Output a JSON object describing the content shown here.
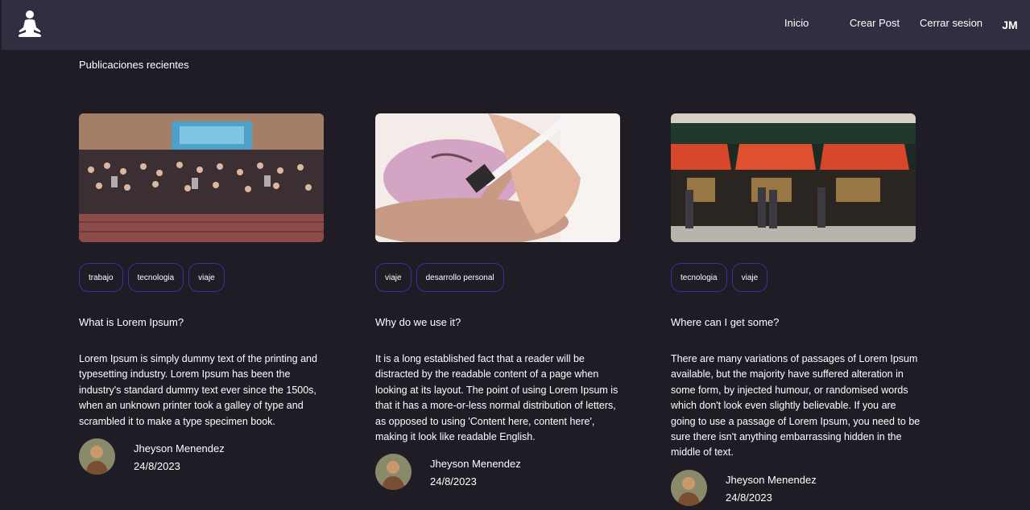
{
  "nav": {
    "links": [
      "Inicio",
      "Crear Post",
      "Cerrar sesion"
    ],
    "user_initials": "JM",
    "logo_icon": "meditation-icon"
  },
  "section_title": "Publicaciones recientes",
  "posts": [
    {
      "image": "conference-crowd-photo",
      "tags": [
        "trabajo",
        "tecnologia",
        "viaje"
      ],
      "title": "What is Lorem Ipsum?",
      "excerpt": "Lorem Ipsum is simply dummy text of the printing and typesetting industry. Lorem Ipsum has been the industry's standard dummy text ever since the 1500s, when an unknown printer took a galley of type and scrambled it to make a type specimen book.",
      "author": "Jheyson Menendez",
      "date": "24/8/2023"
    },
    {
      "image": "facial-mask-photo",
      "tags": [
        "viaje",
        "desarrollo personal"
      ],
      "title": "Why do we use it?",
      "excerpt": "It is a long established fact that a reader will be distracted by the readable content of a page when looking at its layout. The point of using Lorem Ipsum is that it has a more-or-less normal distribution of letters, as opposed to using 'Content here, content here', making it look like readable English.",
      "author": "Jheyson Menendez",
      "date": "24/8/2023"
    },
    {
      "image": "street-storefront-photo",
      "tags": [
        "tecnologia",
        "viaje"
      ],
      "title": "Where can I get some?",
      "excerpt": "There are many variations of passages of Lorem Ipsum available, but the majority have suffered alteration in some form, by injected humour, or randomised words which don't look even slightly believable.  If you are going to use a passage of Lorem Ipsum, you need to be sure there isn't anything embarrassing hidden in the middle of text.",
      "author": "Jheyson Menendez",
      "date": "24/8/2023"
    }
  ],
  "colors": {
    "background": "#1f1c25",
    "navbar": "#322e42",
    "tag_border": "#3b2fa0",
    "text": "#ffffff"
  }
}
